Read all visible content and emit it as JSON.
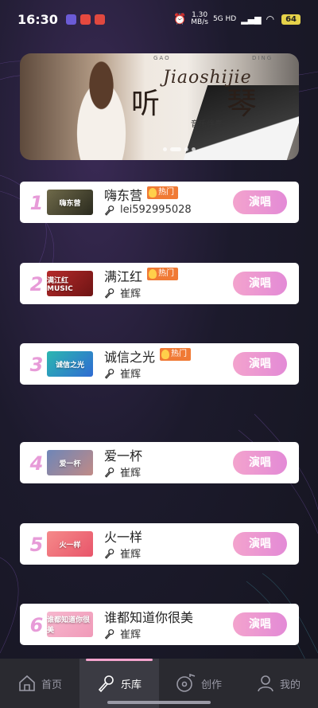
{
  "status_bar": {
    "time": "16:30",
    "net_speed_value": "1.30",
    "net_speed_unit": "MB/s",
    "signal": "5G HD",
    "battery": "64",
    "app_colors": [
      "#6b5bd6",
      "#e6493f",
      "#e0483f"
    ]
  },
  "banner": {
    "gao": "GAO",
    "ding": "DING",
    "script": "Jiaoshijie",
    "title_left": "听",
    "title_right": "琴",
    "subtitle": "音乐伴奏",
    "slides": 4,
    "active_slide": 1
  },
  "songs": [
    {
      "rank": "1",
      "title": "嗨东营",
      "hot": true,
      "hot_label": "热门",
      "artist": "lei592995028",
      "cover_text": "嗨东营",
      "cover_colors": [
        "#6f6a4a",
        "#2a2a1e"
      ]
    },
    {
      "rank": "2",
      "title": "满江红",
      "hot": true,
      "hot_label": "热门",
      "artist": "崔辉",
      "cover_text": "满江红 MUSIC",
      "cover_colors": [
        "#b52a2a",
        "#6e1414"
      ]
    },
    {
      "rank": "3",
      "title": "诚信之光",
      "hot": true,
      "hot_label": "热门",
      "artist": "崔辉",
      "cover_text": "诚信之光",
      "cover_colors": [
        "#2bb7b0",
        "#2f6bd3"
      ]
    },
    {
      "rank": "4",
      "title": "爱一杯",
      "hot": false,
      "hot_label": "",
      "artist": "崔辉",
      "cover_text": "爱一杯",
      "cover_colors": [
        "#6e86b8",
        "#c08a86"
      ]
    },
    {
      "rank": "5",
      "title": "火一样",
      "hot": false,
      "hot_label": "",
      "artist": "崔辉",
      "cover_text": "火一样",
      "cover_colors": [
        "#f58a8a",
        "#e8556a"
      ]
    },
    {
      "rank": "6",
      "title": "谁都知道你很美",
      "hot": false,
      "hot_label": "",
      "artist": "崔辉",
      "cover_text": "谁都知道你很美",
      "cover_colors": [
        "#f7b8cf",
        "#f09ab8"
      ]
    }
  ],
  "sing_label": "演唱",
  "nav": [
    {
      "label": "首页",
      "icon": "home-icon",
      "active": false
    },
    {
      "label": "乐库",
      "icon": "microphone-icon",
      "active": true
    },
    {
      "label": "创作",
      "icon": "music-disc-icon",
      "active": false
    },
    {
      "label": "我的",
      "icon": "user-icon",
      "active": false
    }
  ]
}
